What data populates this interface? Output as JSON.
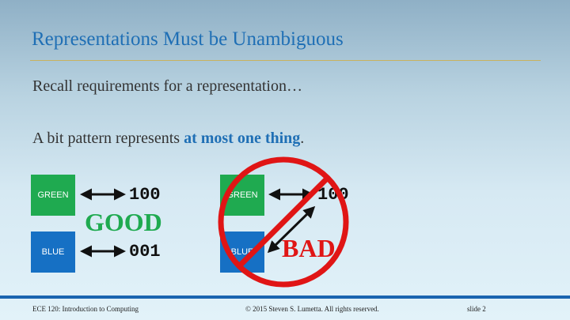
{
  "slide": {
    "title": "Representations Must be Unambiguous",
    "line1": "Recall requirements for a representation…",
    "line2_prefix": "A bit pattern represents ",
    "line2_emphasis": "at most one thing",
    "line2_suffix": "."
  },
  "good_example": {
    "green_label": "GREEN",
    "blue_label": "BLUE",
    "green_code": "100",
    "blue_code": "001",
    "verdict": "GOOD"
  },
  "bad_example": {
    "green_label": "GREEN",
    "blue_label": "BLUE",
    "code": "100",
    "verdict": "BAD"
  },
  "footer": {
    "course": "ECE 120: Introduction to Computing",
    "copyright": "© 2015 Steven S. Lumetta.  All rights reserved.",
    "slide_number": "slide 2"
  },
  "colors": {
    "title_blue": "#1f6fb5",
    "green_box": "#1faa50",
    "blue_box": "#1670c4",
    "bad_red": "#e01515"
  }
}
